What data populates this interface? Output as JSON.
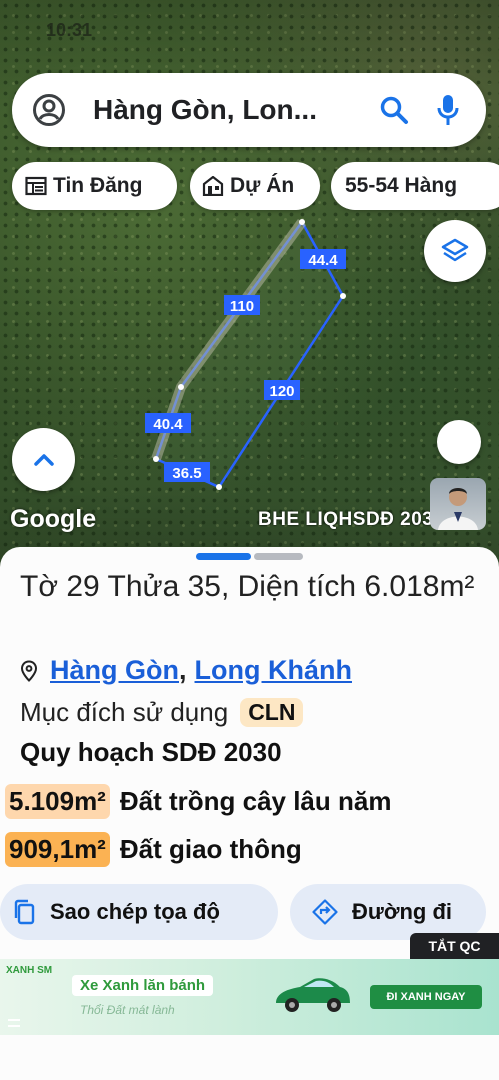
{
  "status_bar": {
    "time": "10:31"
  },
  "search": {
    "query": "Hàng Gòn, Lon..."
  },
  "chips": [
    {
      "label": "Tin Đăng",
      "icon": "news-icon"
    },
    {
      "label": "Dự Án",
      "icon": "building-icon"
    },
    {
      "label": "55-54 Hàng",
      "icon": ""
    }
  ],
  "map": {
    "google_label": "Google",
    "watermark": "BHE LIQHSDĐ 2030",
    "edge_labels": [
      "44.4",
      "110",
      "120",
      "40.4",
      "36.5"
    ]
  },
  "parcel": {
    "title": "Tờ 29 Thửa 35, Diện tích 6.018m²",
    "ward": "Hàng Gòn",
    "separator": ",",
    "city": "Long Khánh",
    "purpose_label": "Mục đích sử dụng",
    "purpose_code": "CLN",
    "plan_title": "Quy hoạch SDĐ 2030",
    "areas": [
      {
        "value": "5.109m²",
        "label": "Đất trồng cây lâu năm",
        "color": "#fed7ad"
      },
      {
        "value": "909,1m²",
        "label": "Đất giao thông",
        "color": "#fbb253"
      }
    ]
  },
  "actions": {
    "copy_label": "Sao chép tọa độ",
    "directions_label": "Đường đi"
  },
  "ad": {
    "close_label": "TẮT QC",
    "brand": "XANH SM",
    "headline": "Xe Xanh lăn bánh",
    "tagline": "Thổi Đất mát lành",
    "cta": "ĐI XANH NGAY"
  },
  "colors": {
    "accent": "#1a73e8",
    "link": "#1a5fd8",
    "parcel_line": "#2962ff"
  }
}
